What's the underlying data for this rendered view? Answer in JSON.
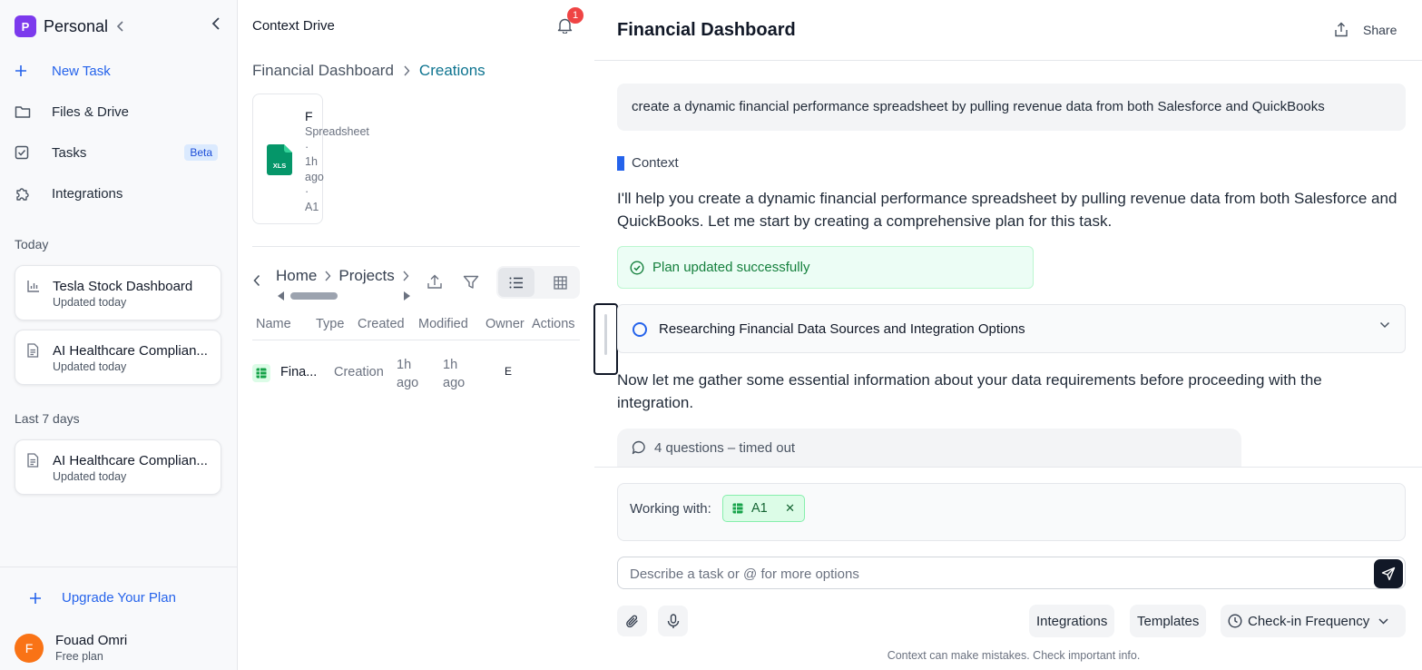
{
  "sidebar": {
    "workspace": {
      "initial": "P",
      "name": "Personal"
    },
    "nav": [
      {
        "label": "New Task",
        "icon": "plus-icon"
      },
      {
        "label": "Files & Drive",
        "icon": "folder-icon"
      },
      {
        "label": "Tasks",
        "icon": "checkbox-icon",
        "badge": "Beta"
      },
      {
        "label": "Integrations",
        "icon": "puzzle-icon"
      }
    ],
    "today_label": "Today",
    "today": [
      {
        "title": "Tesla Stock Dashboard",
        "subtitle": "Updated today",
        "icon": "chart-icon"
      },
      {
        "title": "AI Healthcare Complian...",
        "subtitle": "Updated today",
        "icon": "document-icon"
      }
    ],
    "last7_label": "Last 7 days",
    "last7": [
      {
        "title": "AI Healthcare Complian...",
        "subtitle": "Updated today",
        "icon": "document-icon"
      }
    ],
    "upgrade_label": "Upgrade Your Plan",
    "user": {
      "initial": "F",
      "name": "Fouad Omri",
      "plan": "Free plan"
    }
  },
  "drive": {
    "title": "Context Drive",
    "notifications": "1",
    "breadcrumb": {
      "parent": "Financial Dashboard",
      "current": "Creations"
    },
    "file_card": {
      "name": "F",
      "type": "Spreadsheet",
      "meta": [
        "·",
        "1h",
        "ago",
        "·",
        "A1"
      ],
      "icon_text": "XLS"
    },
    "path": [
      "Home",
      "Projects"
    ],
    "columns": [
      "Name",
      "Type",
      "Created",
      "Modified",
      "Owner",
      "Actions"
    ],
    "rows": [
      {
        "name": "Fina...",
        "type": "Creation",
        "created": [
          "1h",
          "ago"
        ],
        "modified": [
          "1h",
          "ago"
        ],
        "owner": "E"
      }
    ]
  },
  "chat": {
    "title": "Financial Dashboard",
    "share_label": "Share",
    "user_message": "create a dynamic financial performance spreadsheet by pulling revenue data from both Salesforce and QuickBooks",
    "context_label": "Context",
    "reply": "I'll help you create a dynamic financial performance spreadsheet by pulling revenue data from both Salesforce and QuickBooks. Let me start by creating a comprehensive plan for this task.",
    "plan_status": "Plan updated successfully",
    "step": "Researching Financial Data Sources and Integration Options",
    "reply2": "Now let me gather some essential information about your data requirements before proceeding with the integration.",
    "questions": "4 questions – timed out",
    "working_label": "Working with:",
    "working_chip": "A1",
    "composer_placeholder": "Describe a task or @ for more options",
    "integrations_label": "Integrations",
    "templates_label": "Templates",
    "checkin_label": "Check-in Frequency",
    "disclaimer": "Context can make mistakes. Check important info."
  },
  "colors": {
    "accent": "#2563eb",
    "workspace": "#7c3aed",
    "avatar": "#f97316",
    "success": "#15803d",
    "notification": "#ef4444"
  }
}
